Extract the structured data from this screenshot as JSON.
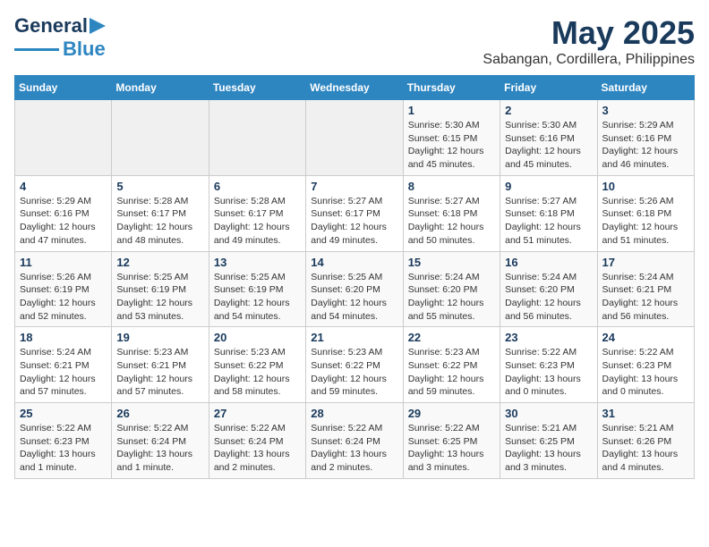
{
  "logo": {
    "text_general": "General",
    "text_blue": "Blue"
  },
  "title": "May 2025",
  "subtitle": "Sabangan, Cordillera, Philippines",
  "weekdays": [
    "Sunday",
    "Monday",
    "Tuesday",
    "Wednesday",
    "Thursday",
    "Friday",
    "Saturday"
  ],
  "weeks": [
    [
      {
        "day": "",
        "info": ""
      },
      {
        "day": "",
        "info": ""
      },
      {
        "day": "",
        "info": ""
      },
      {
        "day": "",
        "info": ""
      },
      {
        "day": "1",
        "info": "Sunrise: 5:30 AM\nSunset: 6:15 PM\nDaylight: 12 hours\nand 45 minutes."
      },
      {
        "day": "2",
        "info": "Sunrise: 5:30 AM\nSunset: 6:16 PM\nDaylight: 12 hours\nand 45 minutes."
      },
      {
        "day": "3",
        "info": "Sunrise: 5:29 AM\nSunset: 6:16 PM\nDaylight: 12 hours\nand 46 minutes."
      }
    ],
    [
      {
        "day": "4",
        "info": "Sunrise: 5:29 AM\nSunset: 6:16 PM\nDaylight: 12 hours\nand 47 minutes."
      },
      {
        "day": "5",
        "info": "Sunrise: 5:28 AM\nSunset: 6:17 PM\nDaylight: 12 hours\nand 48 minutes."
      },
      {
        "day": "6",
        "info": "Sunrise: 5:28 AM\nSunset: 6:17 PM\nDaylight: 12 hours\nand 49 minutes."
      },
      {
        "day": "7",
        "info": "Sunrise: 5:27 AM\nSunset: 6:17 PM\nDaylight: 12 hours\nand 49 minutes."
      },
      {
        "day": "8",
        "info": "Sunrise: 5:27 AM\nSunset: 6:18 PM\nDaylight: 12 hours\nand 50 minutes."
      },
      {
        "day": "9",
        "info": "Sunrise: 5:27 AM\nSunset: 6:18 PM\nDaylight: 12 hours\nand 51 minutes."
      },
      {
        "day": "10",
        "info": "Sunrise: 5:26 AM\nSunset: 6:18 PM\nDaylight: 12 hours\nand 51 minutes."
      }
    ],
    [
      {
        "day": "11",
        "info": "Sunrise: 5:26 AM\nSunset: 6:19 PM\nDaylight: 12 hours\nand 52 minutes."
      },
      {
        "day": "12",
        "info": "Sunrise: 5:25 AM\nSunset: 6:19 PM\nDaylight: 12 hours\nand 53 minutes."
      },
      {
        "day": "13",
        "info": "Sunrise: 5:25 AM\nSunset: 6:19 PM\nDaylight: 12 hours\nand 54 minutes."
      },
      {
        "day": "14",
        "info": "Sunrise: 5:25 AM\nSunset: 6:20 PM\nDaylight: 12 hours\nand 54 minutes."
      },
      {
        "day": "15",
        "info": "Sunrise: 5:24 AM\nSunset: 6:20 PM\nDaylight: 12 hours\nand 55 minutes."
      },
      {
        "day": "16",
        "info": "Sunrise: 5:24 AM\nSunset: 6:20 PM\nDaylight: 12 hours\nand 56 minutes."
      },
      {
        "day": "17",
        "info": "Sunrise: 5:24 AM\nSunset: 6:21 PM\nDaylight: 12 hours\nand 56 minutes."
      }
    ],
    [
      {
        "day": "18",
        "info": "Sunrise: 5:24 AM\nSunset: 6:21 PM\nDaylight: 12 hours\nand 57 minutes."
      },
      {
        "day": "19",
        "info": "Sunrise: 5:23 AM\nSunset: 6:21 PM\nDaylight: 12 hours\nand 57 minutes."
      },
      {
        "day": "20",
        "info": "Sunrise: 5:23 AM\nSunset: 6:22 PM\nDaylight: 12 hours\nand 58 minutes."
      },
      {
        "day": "21",
        "info": "Sunrise: 5:23 AM\nSunset: 6:22 PM\nDaylight: 12 hours\nand 59 minutes."
      },
      {
        "day": "22",
        "info": "Sunrise: 5:23 AM\nSunset: 6:22 PM\nDaylight: 12 hours\nand 59 minutes."
      },
      {
        "day": "23",
        "info": "Sunrise: 5:22 AM\nSunset: 6:23 PM\nDaylight: 13 hours\nand 0 minutes."
      },
      {
        "day": "24",
        "info": "Sunrise: 5:22 AM\nSunset: 6:23 PM\nDaylight: 13 hours\nand 0 minutes."
      }
    ],
    [
      {
        "day": "25",
        "info": "Sunrise: 5:22 AM\nSunset: 6:23 PM\nDaylight: 13 hours\nand 1 minute."
      },
      {
        "day": "26",
        "info": "Sunrise: 5:22 AM\nSunset: 6:24 PM\nDaylight: 13 hours\nand 1 minute."
      },
      {
        "day": "27",
        "info": "Sunrise: 5:22 AM\nSunset: 6:24 PM\nDaylight: 13 hours\nand 2 minutes."
      },
      {
        "day": "28",
        "info": "Sunrise: 5:22 AM\nSunset: 6:24 PM\nDaylight: 13 hours\nand 2 minutes."
      },
      {
        "day": "29",
        "info": "Sunrise: 5:22 AM\nSunset: 6:25 PM\nDaylight: 13 hours\nand 3 minutes."
      },
      {
        "day": "30",
        "info": "Sunrise: 5:21 AM\nSunset: 6:25 PM\nDaylight: 13 hours\nand 3 minutes."
      },
      {
        "day": "31",
        "info": "Sunrise: 5:21 AM\nSunset: 6:26 PM\nDaylight: 13 hours\nand 4 minutes."
      }
    ]
  ]
}
